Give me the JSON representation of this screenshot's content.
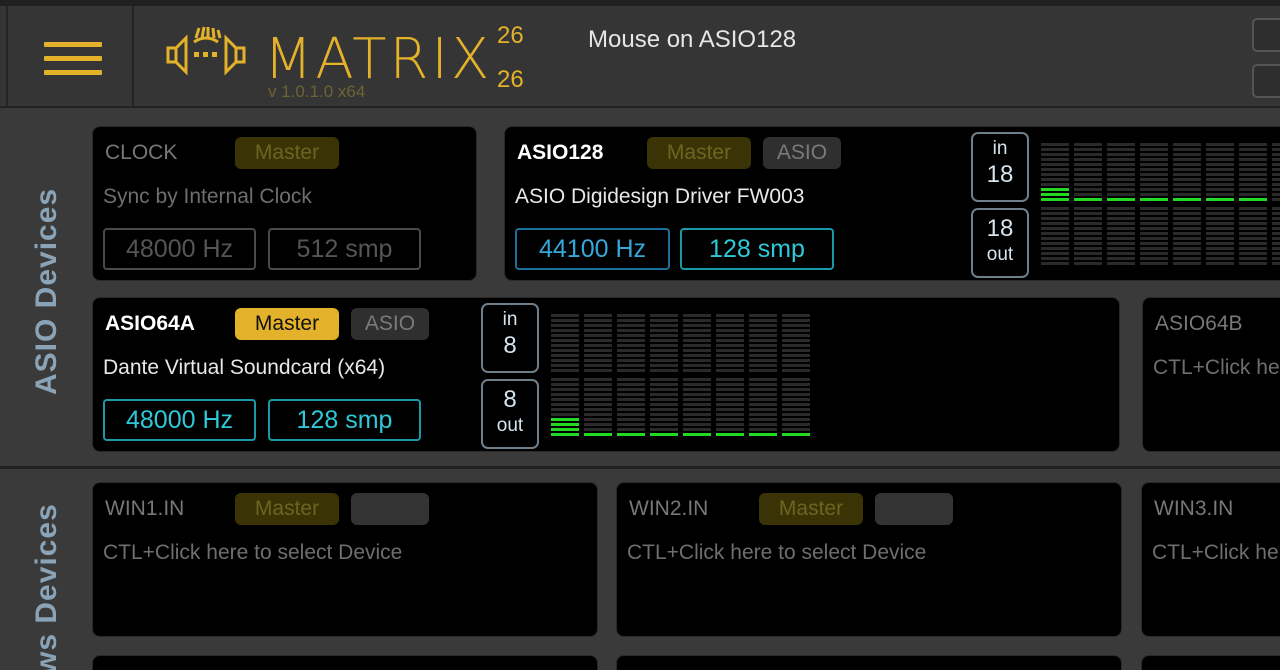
{
  "header": {
    "logo_text": "MATRIX",
    "version": "v 1.0.1.0 x64",
    "channels_top": "26",
    "channels_bottom": "26",
    "mouse_status": "Mouse on ASIO128"
  },
  "asio_section": {
    "label": "ASIO Devices",
    "devices": [
      {
        "name": "CLOCK",
        "master_label": "Master",
        "description": "Sync by Internal Clock",
        "sample_rate": "48000 Hz",
        "buffer": "512 smp"
      },
      {
        "name": "ASIO128",
        "master_label": "Master",
        "type_label": "ASIO",
        "description": "ASIO Digidesign Driver FW003",
        "sample_rate": "44100 Hz",
        "buffer": "128 smp",
        "in_label": "in",
        "in_count": "18",
        "out_label": "out",
        "out_count": "18",
        "in_levels": [
          0.25,
          0.1,
          0.1,
          0.1,
          0.1,
          0.1,
          0.1,
          0.0,
          0.0
        ],
        "out_levels": [
          0,
          0,
          0,
          0,
          0,
          0,
          0,
          0,
          0
        ]
      },
      {
        "name": "ASIO64A",
        "master_label": "Master",
        "type_label": "ASIO",
        "description": "Dante Virtual Soundcard (x64)",
        "sample_rate": "48000 Hz",
        "buffer": "128 smp",
        "in_label": "in",
        "in_count": "8",
        "out_label": "out",
        "out_count": "8",
        "in_levels": [
          0,
          0,
          0,
          0,
          0,
          0,
          0,
          0
        ],
        "out_levels": [
          0.3,
          0.12,
          0.12,
          0.12,
          0.12,
          0.12,
          0.05,
          0.05
        ]
      },
      {
        "name": "ASIO64B",
        "description": "CTL+Click he"
      }
    ]
  },
  "win_section": {
    "label": "ws Devices",
    "devices": [
      {
        "name": "WIN1.IN",
        "master_label": "Master",
        "description": "CTL+Click here to select Device"
      },
      {
        "name": "WIN2.IN",
        "master_label": "Master",
        "description": "CTL+Click here to select Device"
      },
      {
        "name": "WIN3.IN",
        "description": "CTL+Click he"
      }
    ]
  },
  "colors": {
    "accent": "#e3b22a",
    "meter_on": "#22d822",
    "meter_off": "#2a2a2a",
    "blue_field": "#35a8d8",
    "cyan_field": "#2fc8d8"
  }
}
